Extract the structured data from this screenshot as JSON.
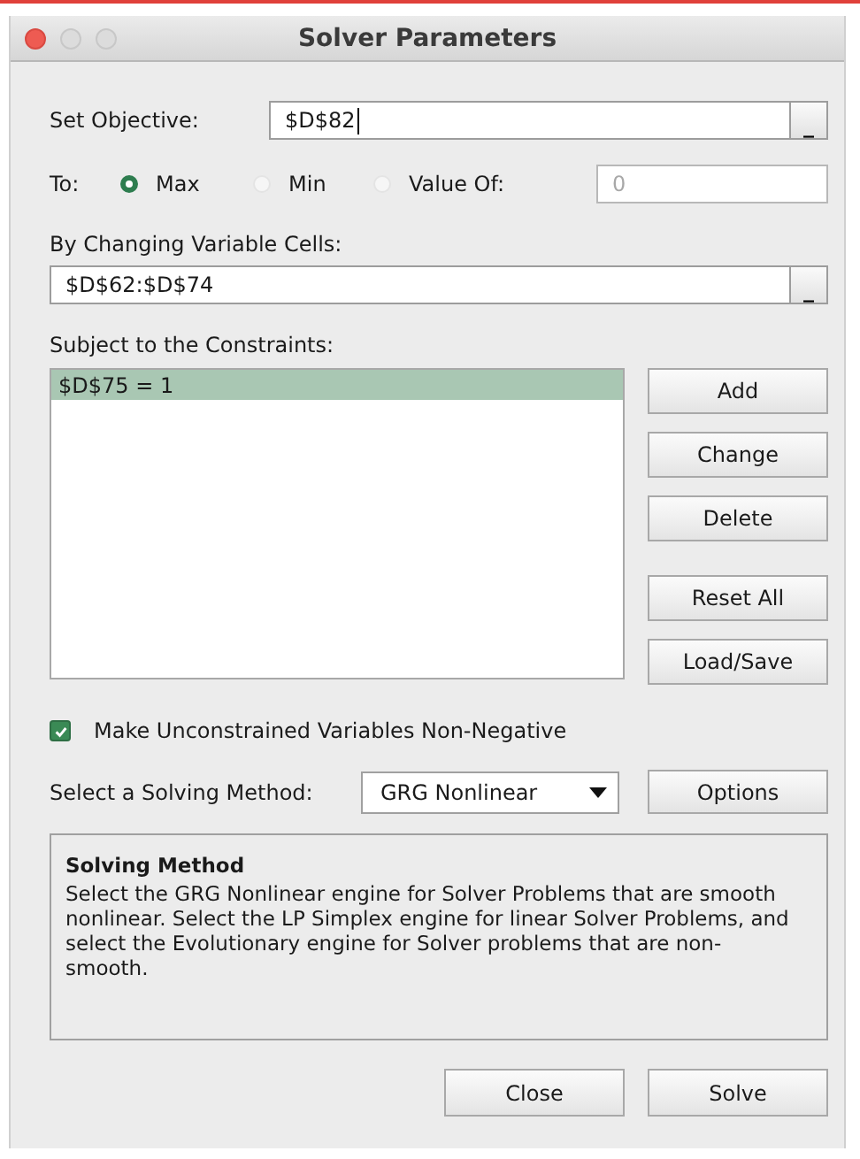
{
  "window": {
    "title": "Solver Parameters"
  },
  "objective": {
    "label": "Set Objective:",
    "value": "$D$82",
    "button": "_"
  },
  "to": {
    "label": "To:",
    "options": [
      {
        "label": "Max",
        "selected": true
      },
      {
        "label": "Min",
        "selected": false
      },
      {
        "label": "Value Of:",
        "selected": false
      }
    ],
    "value_field": {
      "value": "0",
      "disabled": true
    }
  },
  "variable_cells": {
    "label": "By Changing Variable Cells:",
    "value": "$D$62:$D$74",
    "button": "_"
  },
  "constraints": {
    "label": "Subject to the Constraints:",
    "items": [
      {
        "text": "$D$75 = 1",
        "selected": true
      }
    ],
    "buttons": [
      "Add",
      "Change",
      "Delete"
    ],
    "more_buttons": [
      "Reset All",
      "Load/Save"
    ]
  },
  "non_negative": {
    "label": "Make Unconstrained Variables Non-Negative",
    "checked": true
  },
  "method": {
    "label": "Select a Solving Method:",
    "value": "GRG Nonlinear",
    "options_button": "Options"
  },
  "info": {
    "title": "Solving Method",
    "text": "Select the GRG Nonlinear engine for Solver Problems that are smooth nonlinear. Select the LP Simplex engine for linear Solver Problems, and select the Evolutionary engine for Solver problems that are non-smooth."
  },
  "buttons": [
    "Close",
    "Solve"
  ]
}
